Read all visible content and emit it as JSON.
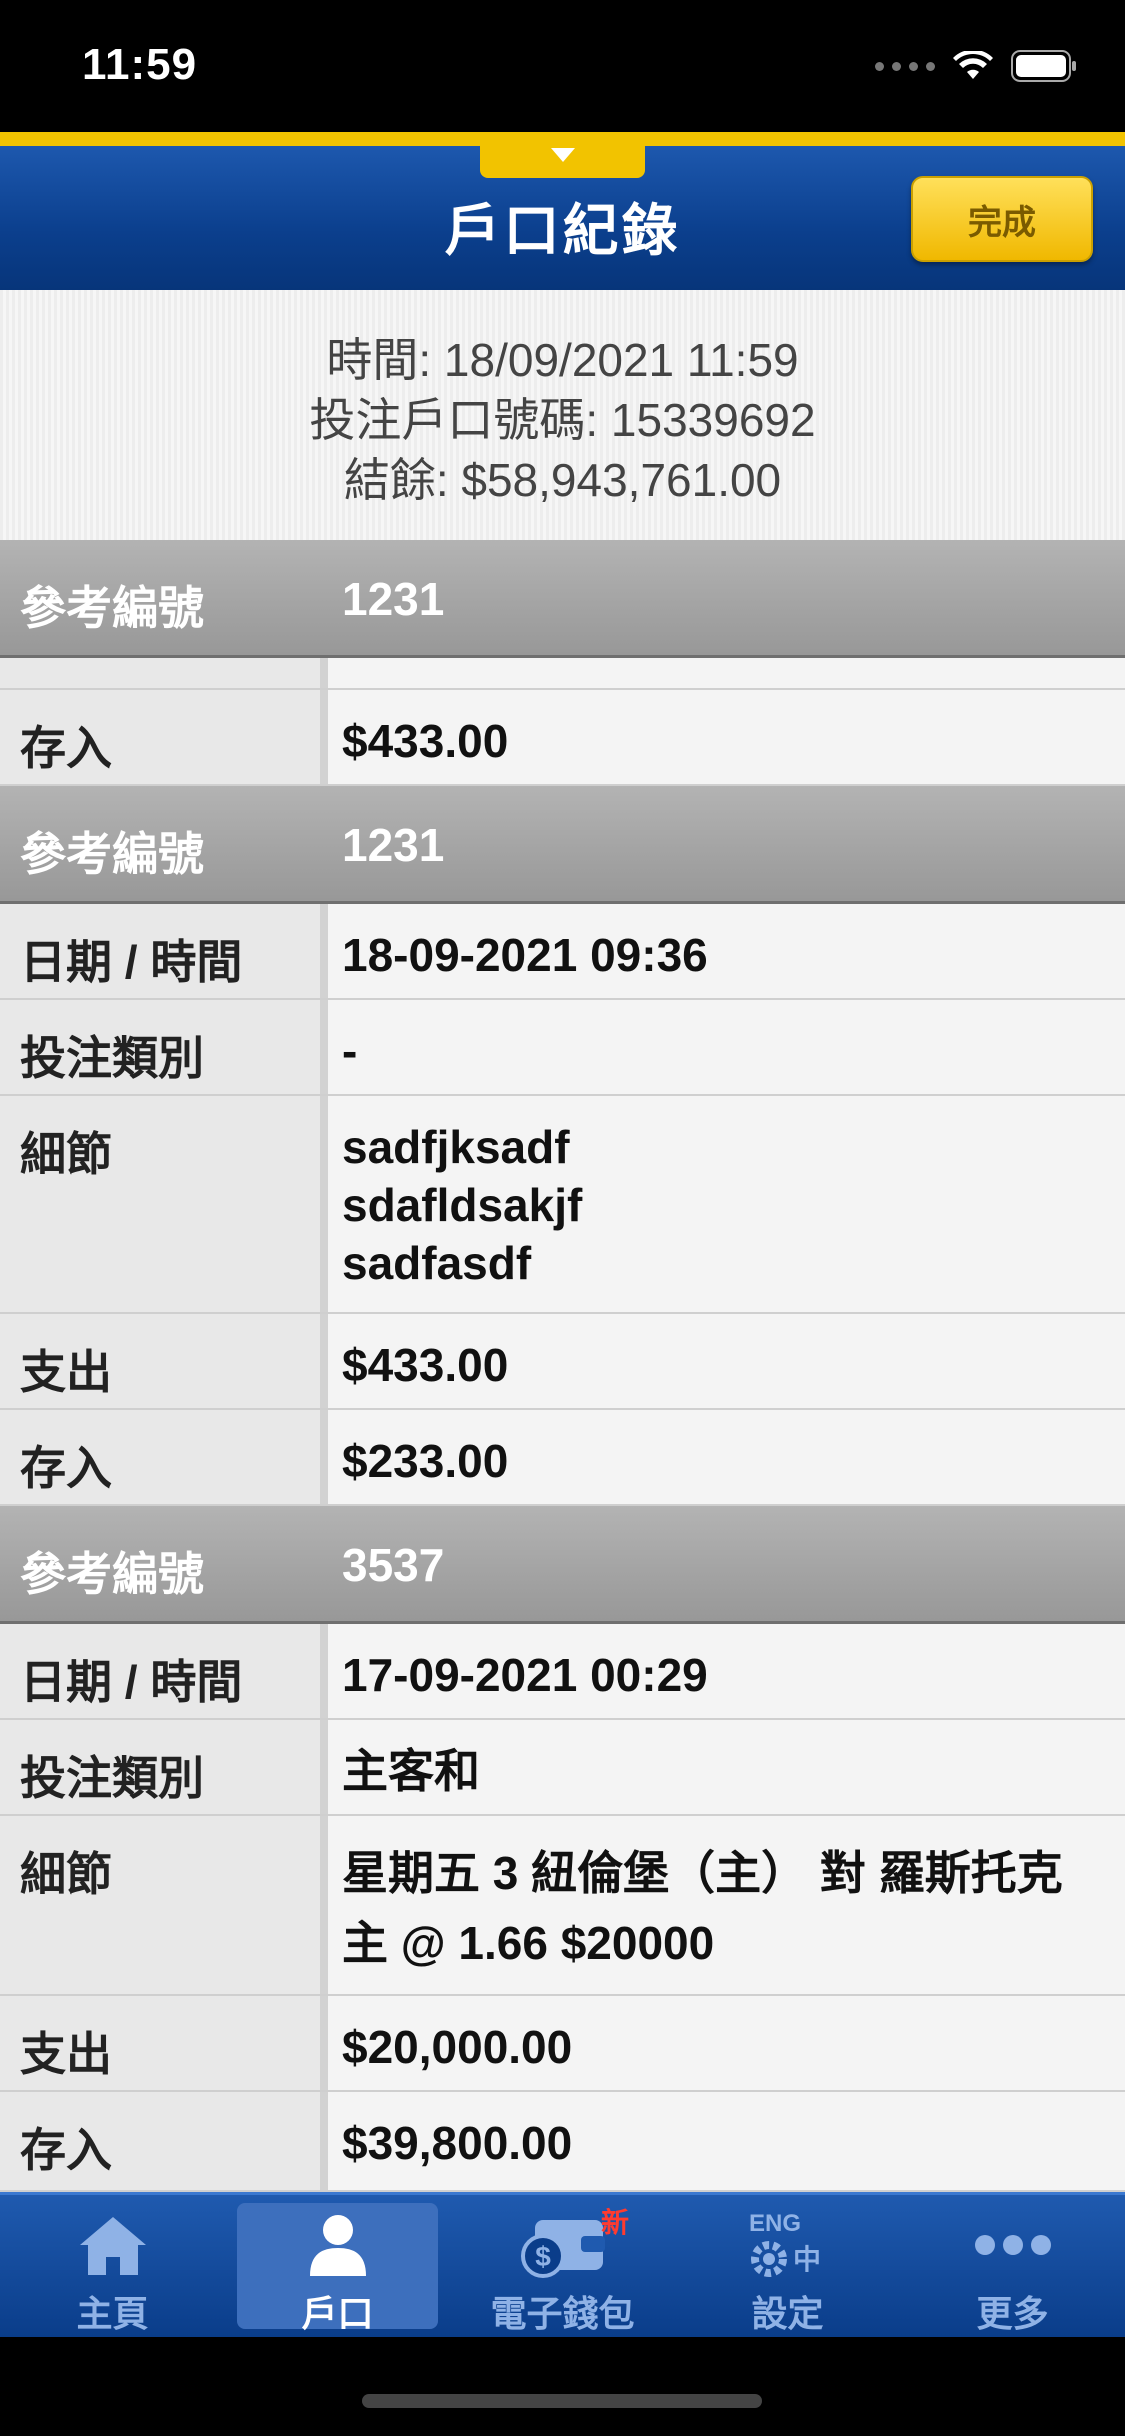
{
  "status": {
    "time": "11:59"
  },
  "header": {
    "title": "戶口紀錄",
    "done_label": "完成"
  },
  "summary": {
    "time_line": "時間: 18/09/2021 11:59",
    "account_line": "投注戶口號碼: 15339692",
    "balance_line": "結餘: $58,943,761.00"
  },
  "labels": {
    "ref": "參考編號",
    "datetime": "日期 / 時間",
    "bet_type": "投注類別",
    "details": "細節",
    "expense": "支出",
    "deposit": "存入"
  },
  "records": [
    {
      "ref": "1231",
      "deposit": "$433.00"
    },
    {
      "ref": "1231",
      "datetime": "18-09-2021 09:36",
      "bet_type": "-",
      "details": "sadfjksadf\nsdafldsakjf\nsadfasdf",
      "expense": "$433.00",
      "deposit": "$233.00"
    },
    {
      "ref": "3537",
      "datetime": "17-09-2021 00:29",
      "bet_type": "主客和",
      "details": "星期五 3 紐倫堡（主） 對 羅斯托克 主 @ 1.66 $20000",
      "expense": "$20,000.00",
      "deposit": "$39,800.00"
    }
  ],
  "tabs": [
    {
      "label": "主頁",
      "icon": "home-icon"
    },
    {
      "label": "戶口",
      "icon": "person-icon"
    },
    {
      "label": "電子錢包",
      "icon": "wallet-icon",
      "badge": "新"
    },
    {
      "label": "設定",
      "icon": "gear-icon",
      "icon_text_top": "ENG",
      "icon_text_side": "中"
    },
    {
      "label": "更多",
      "icon": "more-icon"
    }
  ]
}
